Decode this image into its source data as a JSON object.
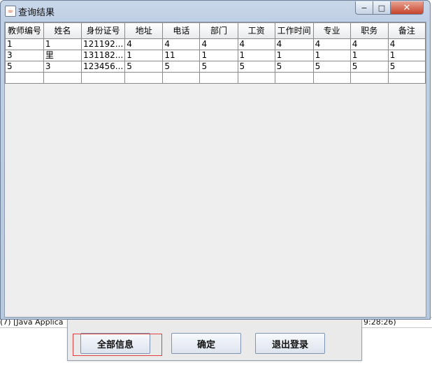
{
  "window": {
    "title": "查询结果",
    "controls": {
      "minimize": "−",
      "maximize": "□",
      "close": "✕"
    }
  },
  "table": {
    "columns": [
      "教师编号",
      "姓名",
      "身份证号",
      "地址",
      "电话",
      "部门",
      "工资",
      "工作时间",
      "专业",
      "职务",
      "备注"
    ],
    "rows": [
      [
        "1",
        "1",
        "121192...",
        "4",
        "4",
        "4",
        "4",
        "4",
        "4",
        "4",
        "4"
      ],
      [
        "3",
        "里",
        "131182...",
        "1",
        "11",
        "1",
        "1",
        "1",
        "1",
        "1",
        "1"
      ],
      [
        "5",
        "3",
        "123456...",
        "5",
        "5",
        "5",
        "5",
        "5",
        "5",
        "5",
        "5"
      ],
      [
        "",
        "",
        "",
        "",
        "",
        "",
        "",
        "",
        "",
        "",
        ""
      ]
    ]
  },
  "background": {
    "console_left": "(7) [Java Applica",
    "console_right": "9:28:26)",
    "buttons": [
      "全部信息",
      "确定",
      "退出登录"
    ]
  }
}
